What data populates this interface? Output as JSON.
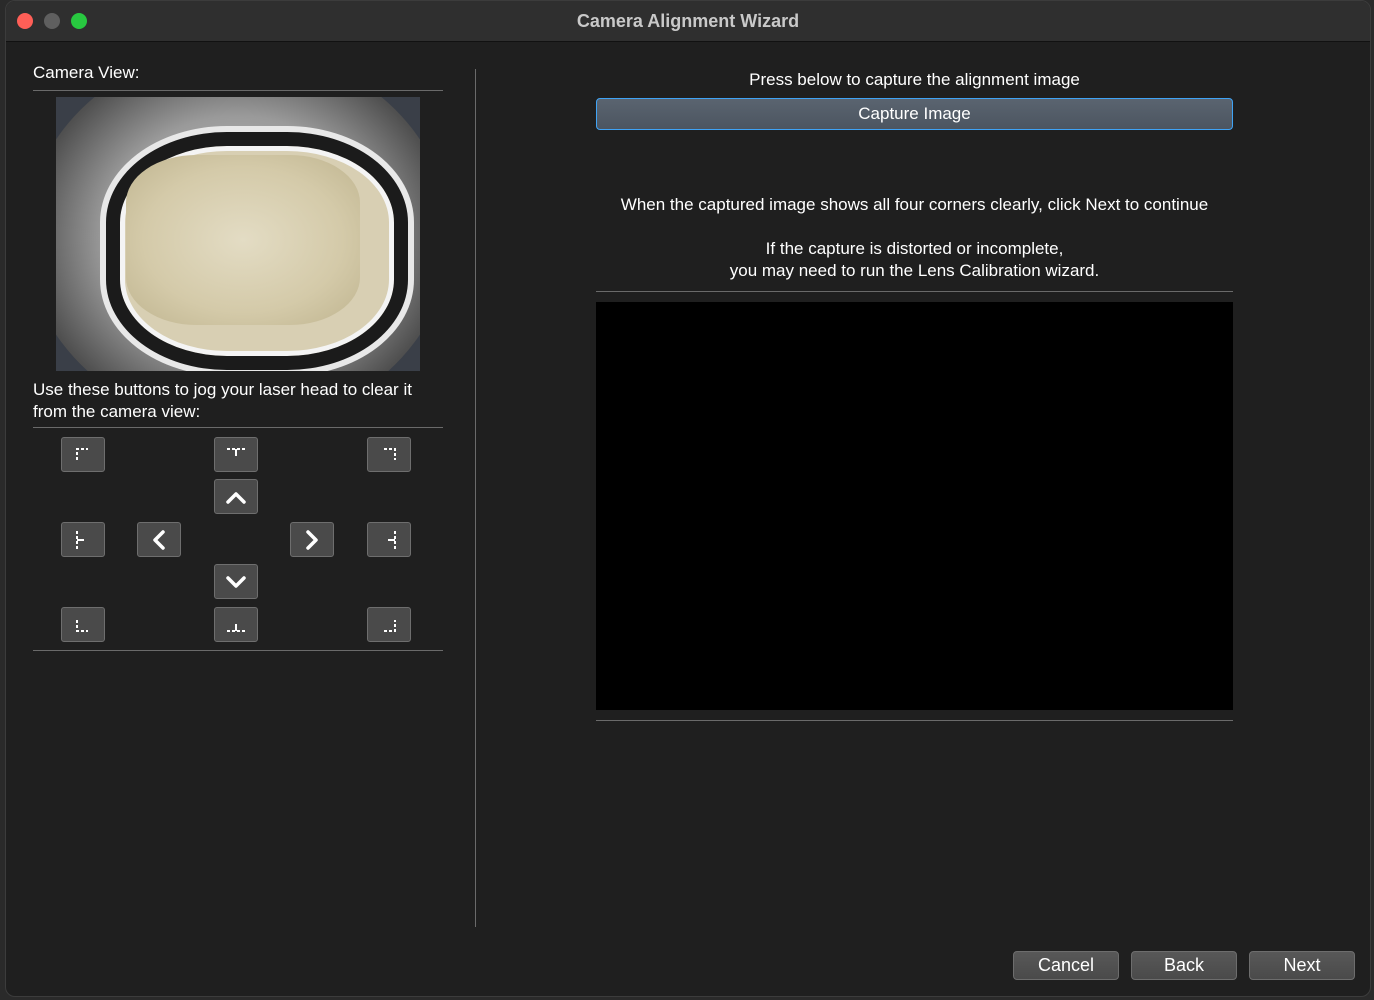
{
  "window": {
    "title": "Camera Alignment Wizard"
  },
  "left_panel": {
    "camera_view_label": "Camera View:",
    "jog_instructions": "Use these buttons to jog your laser head to clear it from the camera view:"
  },
  "right_panel": {
    "capture_prompt": "Press below to capture the alignment image",
    "capture_button_label": "Capture Image",
    "instructions_line": "When the captured image shows all four corners clearly, click Next to continue",
    "warning_line1": "If the capture is distorted or incomplete,",
    "warning_line2": "you may need to run the Lens Calibration wizard."
  },
  "footer": {
    "cancel_label": "Cancel",
    "back_label": "Back",
    "next_label": "Next"
  },
  "colors": {
    "window_bg": "#1f1f1f",
    "titlebar_bg": "#2f2f2f",
    "accent_focus": "#3fa3f5",
    "traffic_close": "#ff5f57",
    "traffic_min": "#5f5f5f",
    "traffic_max": "#28c840"
  },
  "icons": {
    "jog_top_left": "corner-top-left-icon",
    "jog_top_center": "edge-top-center-icon",
    "jog_top_right": "corner-top-right-icon",
    "jog_up": "chevron-up-icon",
    "jog_left_edge": "edge-left-center-icon",
    "jog_left": "chevron-left-icon",
    "jog_right": "chevron-right-icon",
    "jog_right_edge": "edge-right-center-icon",
    "jog_down": "chevron-down-icon",
    "jog_bottom_left": "corner-bottom-left-icon",
    "jog_bottom_center": "edge-bottom-center-icon",
    "jog_bottom_right": "corner-bottom-right-icon"
  }
}
